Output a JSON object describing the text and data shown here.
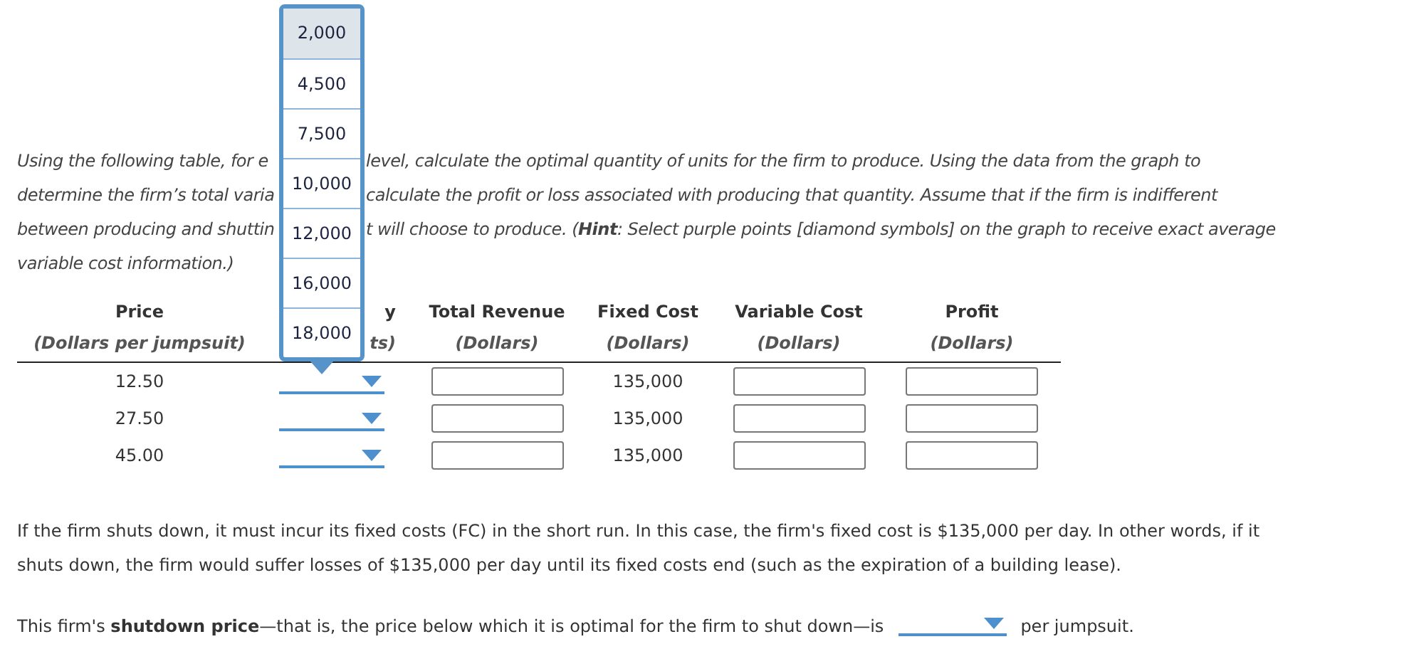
{
  "instructions": {
    "lines": [
      {
        "left": "Using the following table, for e",
        "right": "level, calculate the optimal quantity of units for the firm to produce. Using the data from the graph to"
      },
      {
        "left": "determine the firm’s total varia",
        "right": "calculate the profit or loss associated with producing that quantity. Assume that if the firm is indifferent"
      },
      {
        "left": "between producing and shuttin",
        "right": "t will choose to produce. (**Hint**: Select purple points [diamond symbols] on the graph to receive exact average"
      },
      {
        "left": "variable cost information.)"
      }
    ]
  },
  "dropdown_popup": {
    "options": [
      {
        "label": "2,000",
        "selected": true
      },
      {
        "label": "4,500",
        "selected": false
      },
      {
        "label": "7,500",
        "selected": false
      },
      {
        "label": "10,000",
        "selected": false
      },
      {
        "label": "12,000",
        "selected": false
      },
      {
        "label": "16,000",
        "selected": false
      },
      {
        "label": "18,000",
        "selected": false
      }
    ]
  },
  "table": {
    "columns": [
      {
        "title": "Price",
        "unit": "(Dollars per jumpsuit)"
      },
      {
        "title": "y",
        "unit": "ts)"
      },
      {
        "title": "Total Revenue",
        "unit": "(Dollars)"
      },
      {
        "title": "Fixed Cost",
        "unit": "(Dollars)"
      },
      {
        "title": "Variable Cost",
        "unit": "(Dollars)"
      },
      {
        "title": "Profit",
        "unit": "(Dollars)"
      }
    ],
    "rows": [
      {
        "cells": [
          {
            "kind": "text",
            "text": "12.50"
          },
          {
            "kind": "dropdown"
          },
          {
            "kind": "input"
          },
          {
            "kind": "text",
            "text": "135,000"
          },
          {
            "kind": "input"
          },
          {
            "kind": "input"
          }
        ]
      },
      {
        "cells": [
          {
            "kind": "text",
            "text": "27.50"
          },
          {
            "kind": "dropdown"
          },
          {
            "kind": "input"
          },
          {
            "kind": "text",
            "text": "135,000"
          },
          {
            "kind": "input"
          },
          {
            "kind": "input"
          }
        ]
      },
      {
        "cells": [
          {
            "kind": "text",
            "text": "45.00"
          },
          {
            "kind": "dropdown"
          },
          {
            "kind": "input"
          },
          {
            "kind": "text",
            "text": "135,000"
          },
          {
            "kind": "input"
          },
          {
            "kind": "input"
          }
        ]
      }
    ]
  },
  "note": "If the firm shuts down, it must incur its fixed costs (FC) in the short run. In this case, the firm's fixed cost is $135,000 per day. In other words, if it shuts down, the firm would suffer losses of $135,000 per day until its fixed costs end (such as the expiration of a building lease).",
  "question": {
    "before": "This firm's **shutdown price**—that is, the price below which it is optimal for the firm to shut down—is",
    "after": "per jumpsuit."
  }
}
